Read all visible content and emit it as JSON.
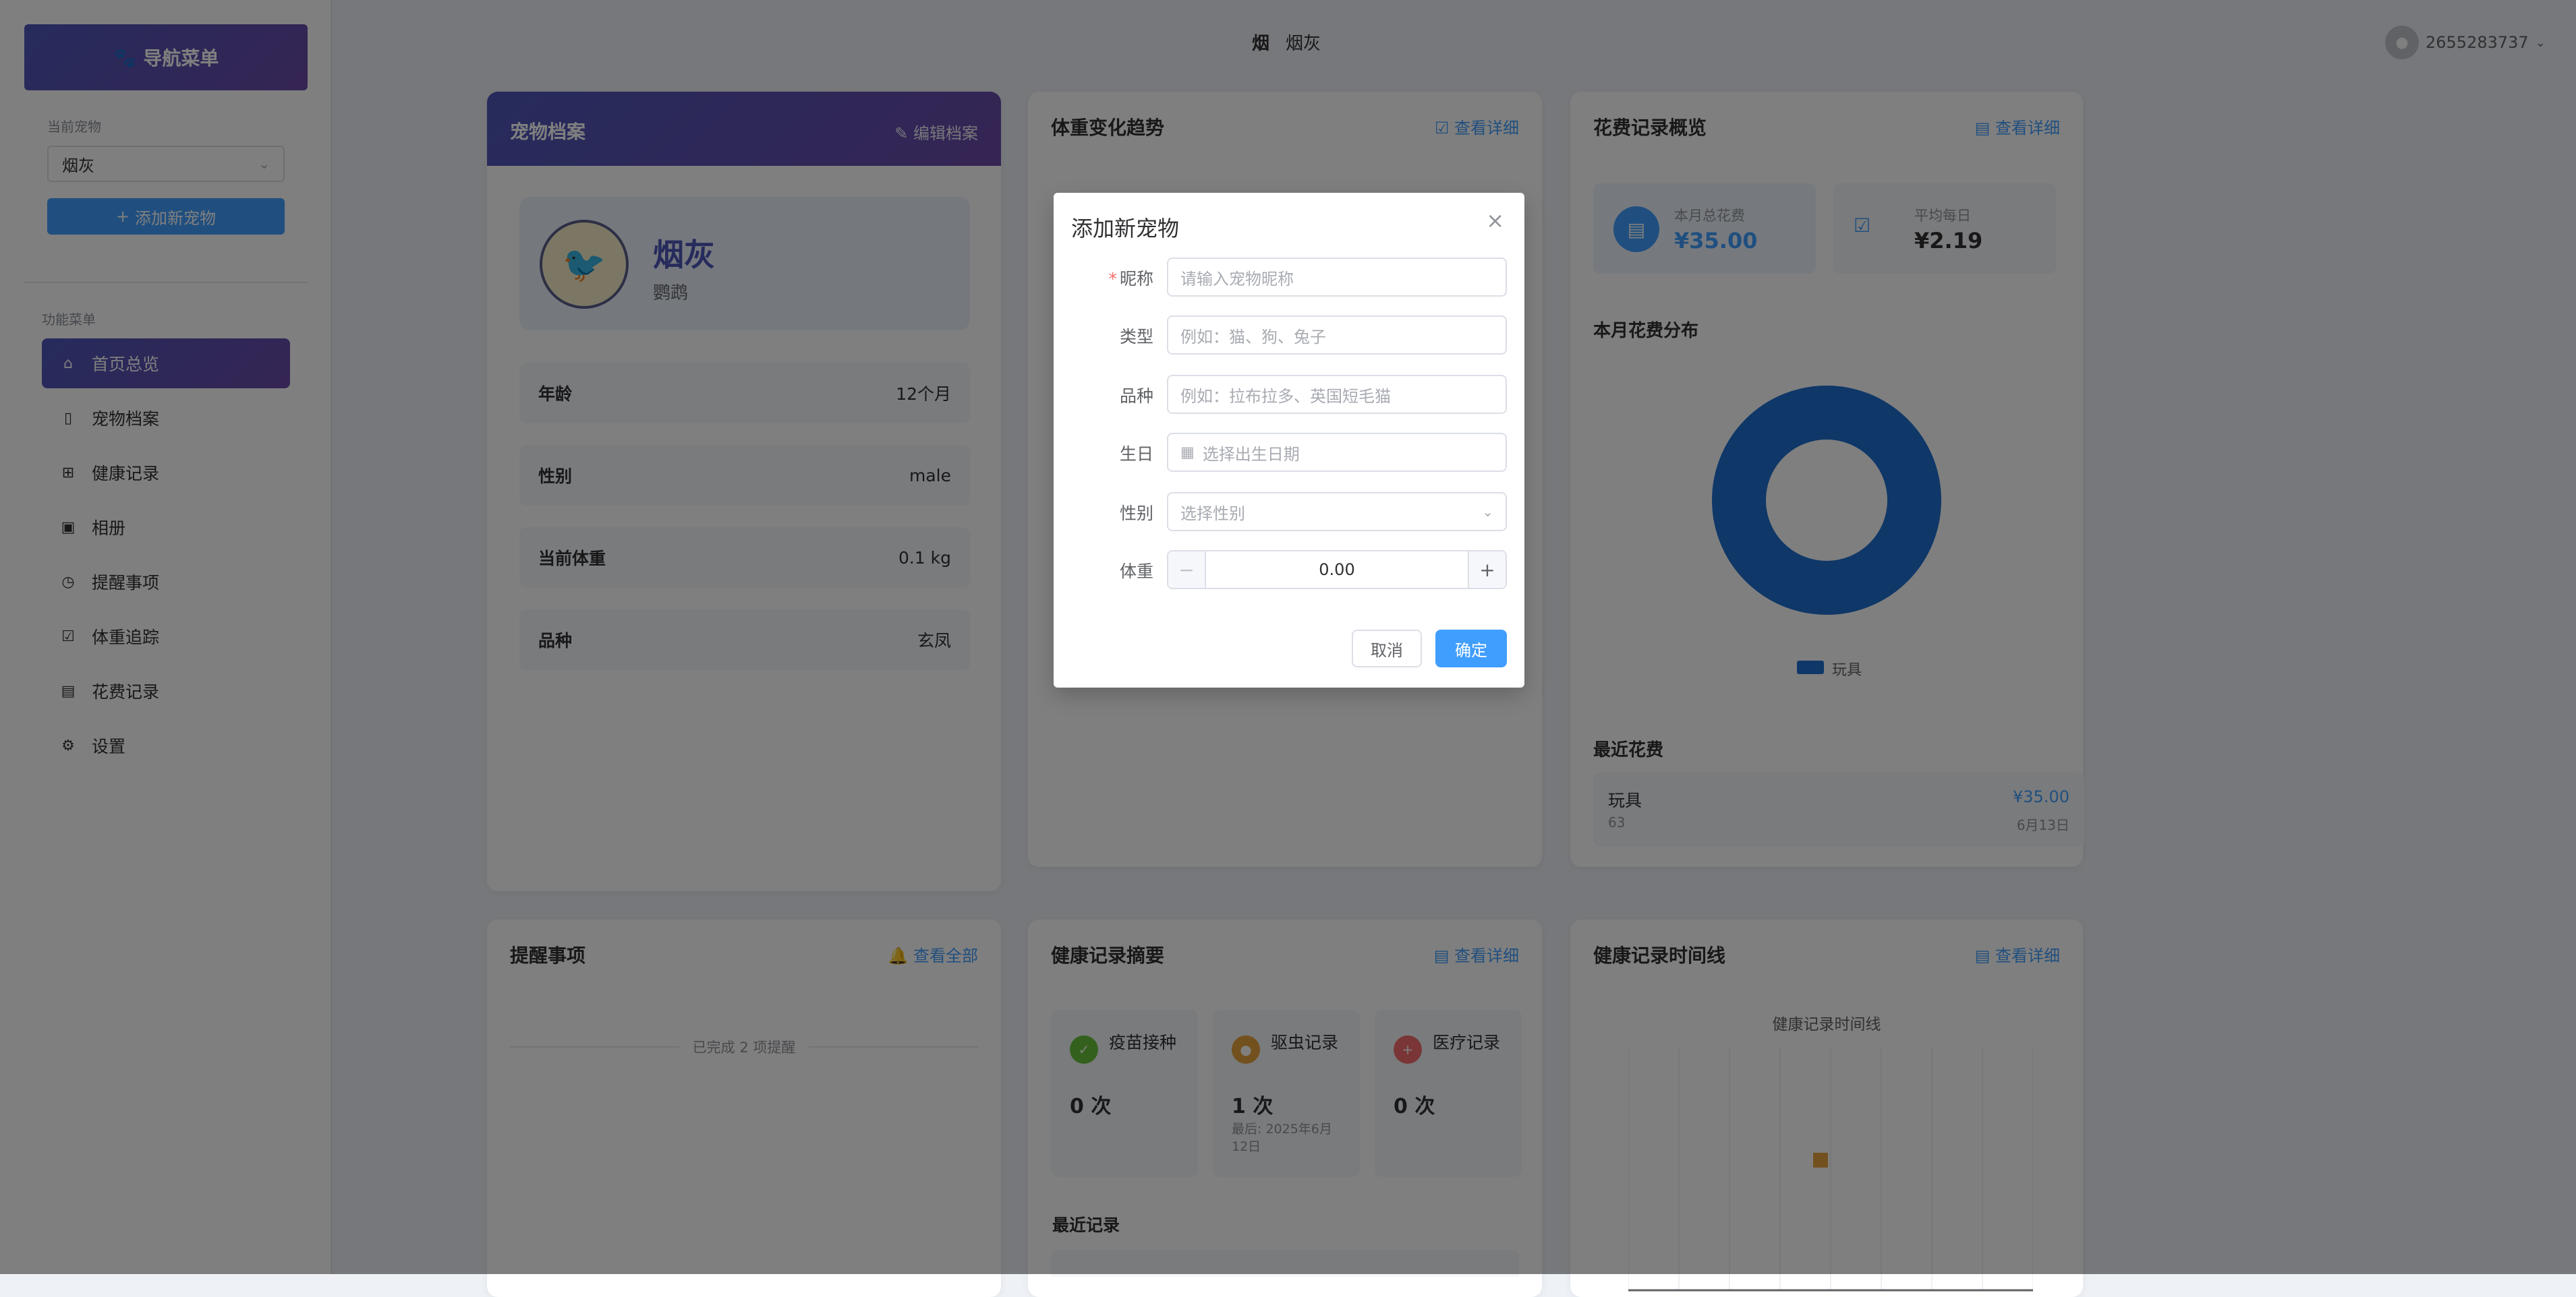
{
  "sidebar": {
    "title": "导航菜单",
    "current_pet_label": "当前宠物",
    "current_pet": "烟灰",
    "add_pet_label": "添加新宠物",
    "menu_section_label": "功能菜单",
    "menu": [
      {
        "label": "首页总览",
        "icon": "home-icon"
      },
      {
        "label": "宠物档案",
        "icon": "document-icon"
      },
      {
        "label": "健康记录",
        "icon": "first-aid-icon"
      },
      {
        "label": "相册",
        "icon": "picture-icon"
      },
      {
        "label": "提醒事项",
        "icon": "clock-icon"
      },
      {
        "label": "体重追踪",
        "icon": "checkbox-icon"
      },
      {
        "label": "花费记录",
        "icon": "money-icon"
      },
      {
        "label": "设置",
        "icon": "gear-icon"
      }
    ]
  },
  "header": {
    "pet_icon_text": "烟",
    "pet_name": "烟灰",
    "user_id": "2655283737"
  },
  "profile": {
    "title": "宠物档案",
    "edit_label": "编辑档案",
    "name": "烟灰",
    "breed_display": "鹦鹉",
    "rows": [
      {
        "k": "年龄",
        "v": "12个月"
      },
      {
        "k": "性别",
        "v": "male"
      },
      {
        "k": "当前体重",
        "v": "0.1 kg"
      },
      {
        "k": "品种",
        "v": "玄凤"
      }
    ]
  },
  "weight": {
    "title": "体重变化趋势",
    "link": "查看详细"
  },
  "expense": {
    "title": "花费记录概览",
    "link": "查看详细",
    "month_total_label": "本月总花费",
    "month_total": "¥35.00",
    "daily_avg_label": "平均每日",
    "daily_avg": "¥2.19",
    "dist_title": "本月花费分布",
    "legend": "玩具",
    "recent_title": "最近花费",
    "recent": {
      "category": "玩具",
      "note": "63",
      "amount": "¥35.00",
      "date": "6月13日"
    }
  },
  "reminders": {
    "title": "提醒事项",
    "link": "查看全部",
    "done_text": "已完成 2 项提醒"
  },
  "health_summary": {
    "title": "健康记录摘要",
    "link": "查看详细",
    "boxes": [
      {
        "label": "疫苗接种",
        "count": "0 次",
        "last": ""
      },
      {
        "label": "驱虫记录",
        "count": "1 次",
        "last": "最后: 2025年6月12日"
      },
      {
        "label": "医疗记录",
        "count": "0 次",
        "last": ""
      }
    ],
    "recent_title": "最近记录"
  },
  "timeline": {
    "title": "健康记录时间线",
    "link": "查看详细",
    "chart_title": "健康记录时间线"
  },
  "dialog": {
    "title": "添加新宠物",
    "nickname_label": "昵称",
    "nickname_placeholder": "请输入宠物昵称",
    "type_label": "类型",
    "type_placeholder": "例如：猫、狗、兔子",
    "breed_label": "品种",
    "breed_placeholder": "例如：拉布拉多、英国短毛猫",
    "birthday_label": "生日",
    "birthday_placeholder": "选择出生日期",
    "gender_label": "性别",
    "gender_placeholder": "选择性别",
    "weight_label": "体重",
    "weight_value": "0.00",
    "cancel_label": "取消",
    "ok_label": "确定"
  },
  "colors": {
    "primary": "#409eff",
    "brand_gradient_start": "#4d57b9",
    "brand_gradient_end": "#6a4aa8",
    "donut": "#1f6fd1",
    "overlay": "rgba(0,0,0,0.5)"
  }
}
